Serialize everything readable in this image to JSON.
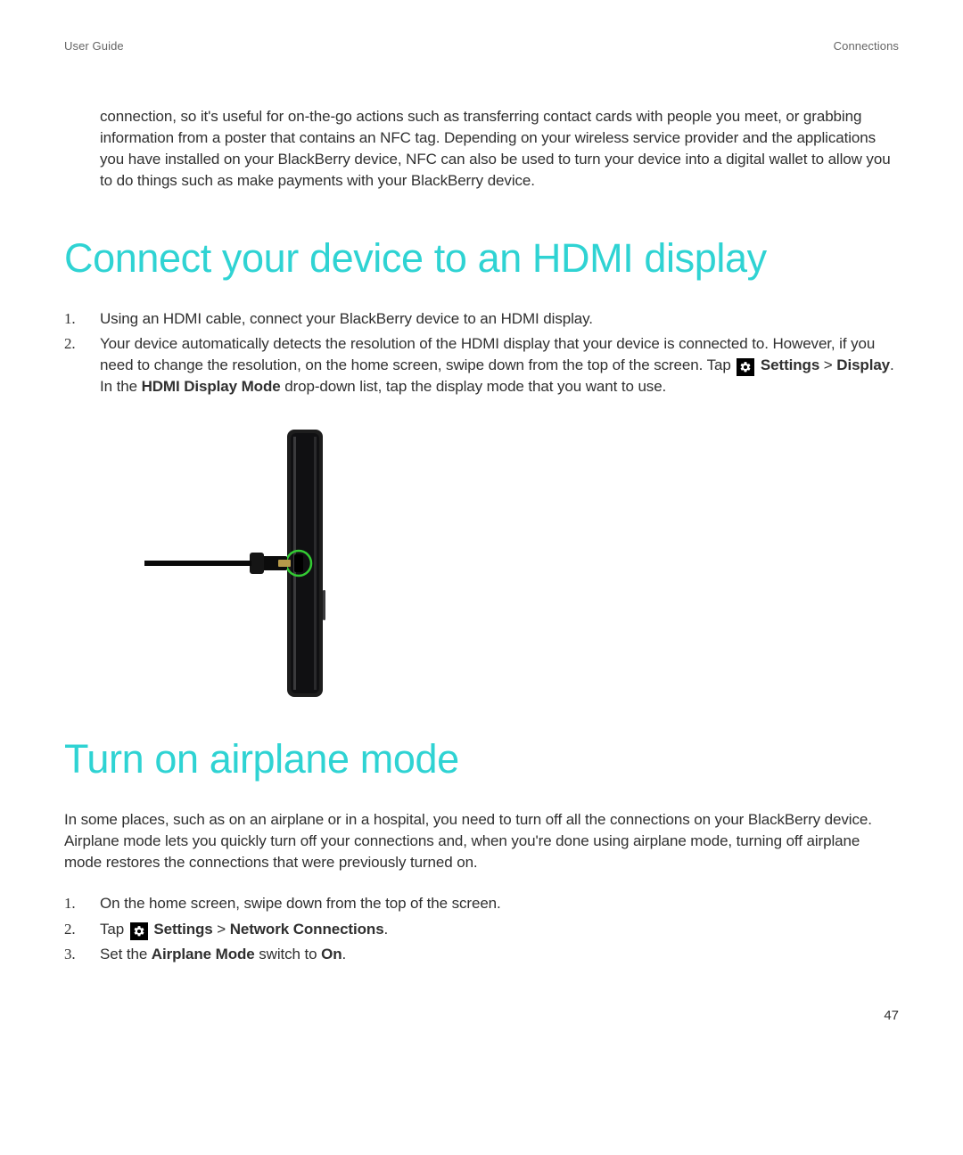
{
  "header": {
    "left": "User Guide",
    "right": "Connections"
  },
  "intro_paragraph": "connection, so it's useful for on-the-go actions such as transferring contact cards with people you meet, or grabbing information from a poster that contains an NFC tag. Depending on your wireless service provider and the applications you have installed on your BlackBerry device, NFC can also be used to turn your device into a digital wallet to allow you to do things such as make payments with your BlackBerry device.",
  "section_hdmi": {
    "heading": "Connect your device to an HDMI display",
    "step1": "Using an HDMI cable, connect your BlackBerry device to an HDMI display.",
    "step2_a": "Your device automatically detects the resolution of the HDMI display that your device is connected to. However, if you need to change the resolution, on the home screen, swipe down from the top of the screen. Tap ",
    "step2_settings": "Settings",
    "step2_sep": " > ",
    "step2_display": "Display",
    "step2_mid": ". In the ",
    "step2_mode": "HDMI Display Mode",
    "step2_end": " drop-down list, tap the display mode that you want to use."
  },
  "section_airplane": {
    "heading": "Turn on airplane mode",
    "intro": "In some places, such as on an airplane or in a hospital, you need to turn off all the connections on your BlackBerry device. Airplane mode lets you quickly turn off your connections and, when you're done using airplane mode, turning off airplane mode restores the connections that were previously turned on.",
    "step1": "On the home screen, swipe down from the top of the screen.",
    "step2_a": "Tap ",
    "step2_settings": "Settings",
    "step2_sep": " > ",
    "step2_network": "Network Connections",
    "step2_end": ".",
    "step3_a": "Set the ",
    "step3_mode": "Airplane Mode",
    "step3_mid": " switch to ",
    "step3_on": "On",
    "step3_end": "."
  },
  "page_number": "47"
}
